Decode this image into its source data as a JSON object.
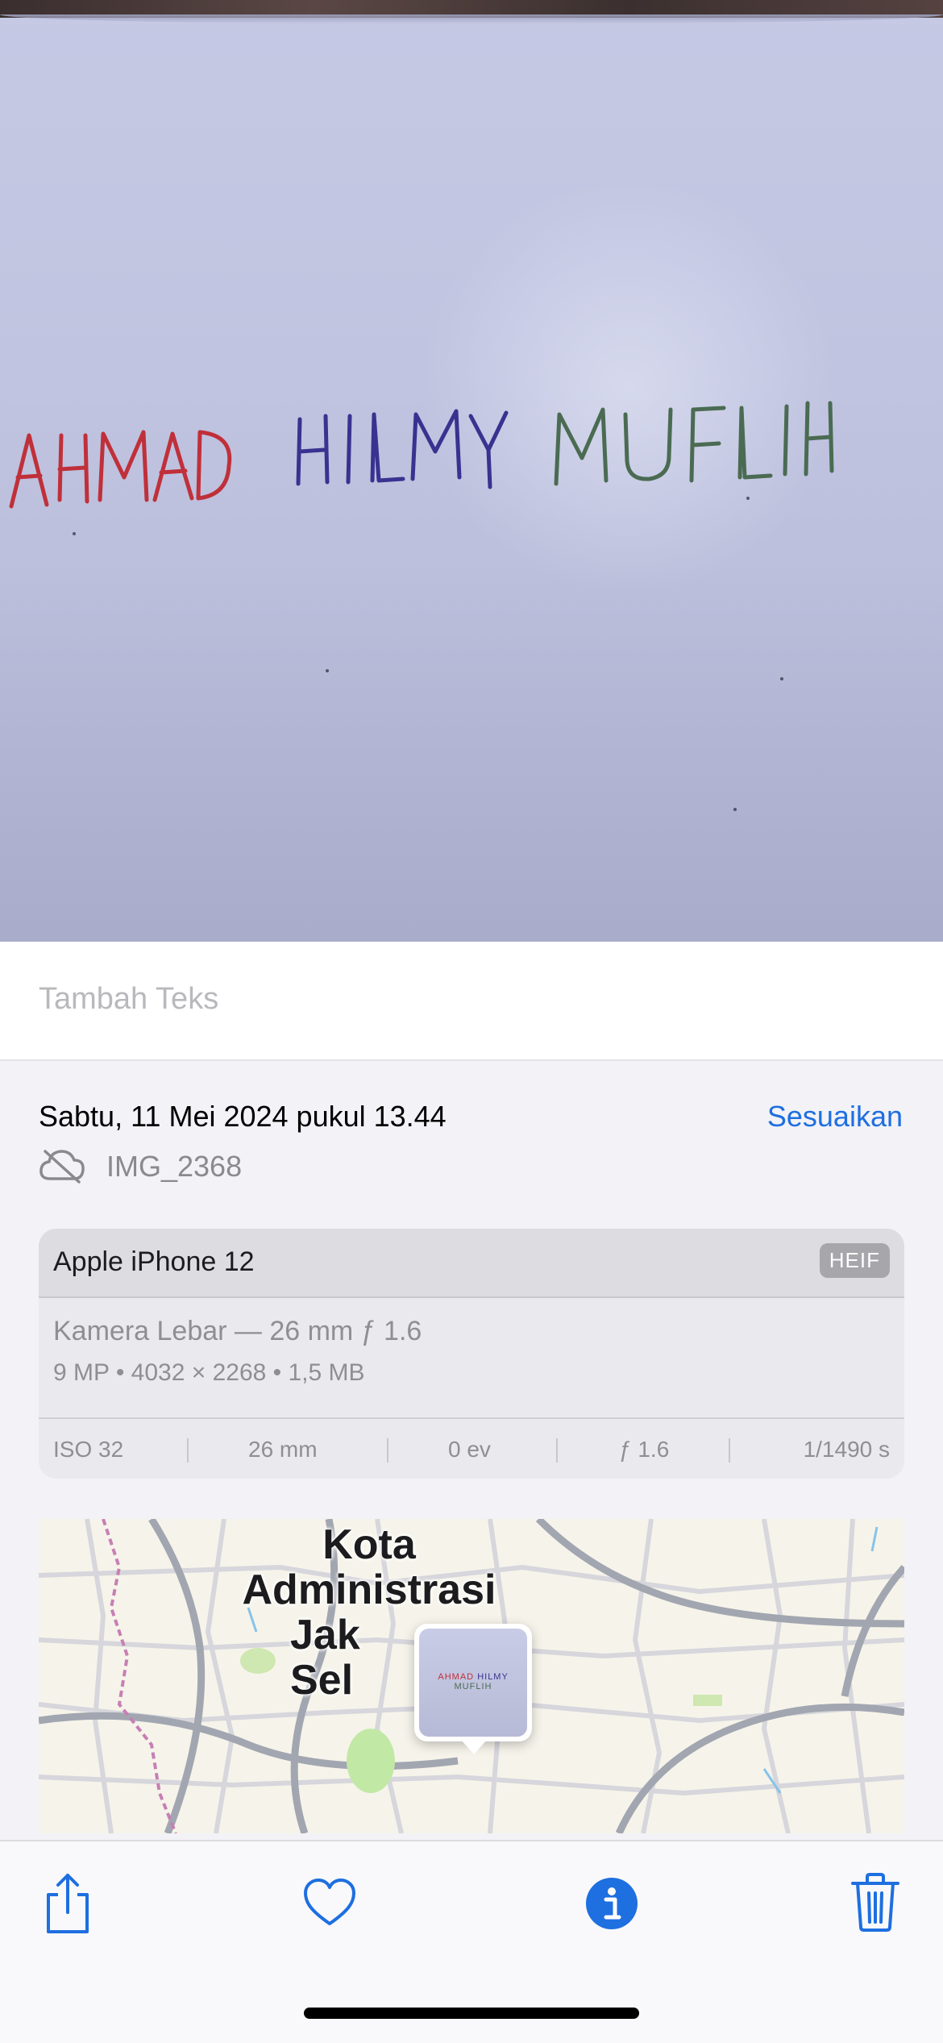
{
  "photo": {
    "handwriting": [
      "AHMAD",
      "HILMY",
      "MUFLIH"
    ],
    "handwriting_colors": [
      "#c0303a",
      "#3a3290",
      "#4a6b52"
    ]
  },
  "caption": {
    "placeholder": "Tambah Teks"
  },
  "info": {
    "date": "Sabtu, 11 Mei 2024 pukul 13.44",
    "adjust_label": "Sesuaikan",
    "filename": "IMG_2368",
    "cloud_icon": "cloud-slash-icon"
  },
  "camera": {
    "device": "Apple iPhone 12",
    "format_badge": "HEIF",
    "lens": "Kamera Lebar — 26 mm ƒ 1.6",
    "specs": "9 MP  •  4032 × 2268  •  1,5 MB",
    "exif": [
      "ISO 32",
      "26 mm",
      "0 ev",
      "ƒ 1.6",
      "1/1490 s"
    ]
  },
  "map": {
    "label_lines": [
      "Kota",
      "Administrasi",
      "Jak",
      "Sel"
    ]
  },
  "toolbar": {
    "icons": [
      "share-icon",
      "heart-icon",
      "info-icon",
      "trash-icon"
    ],
    "accent": "#1e6fe0"
  }
}
